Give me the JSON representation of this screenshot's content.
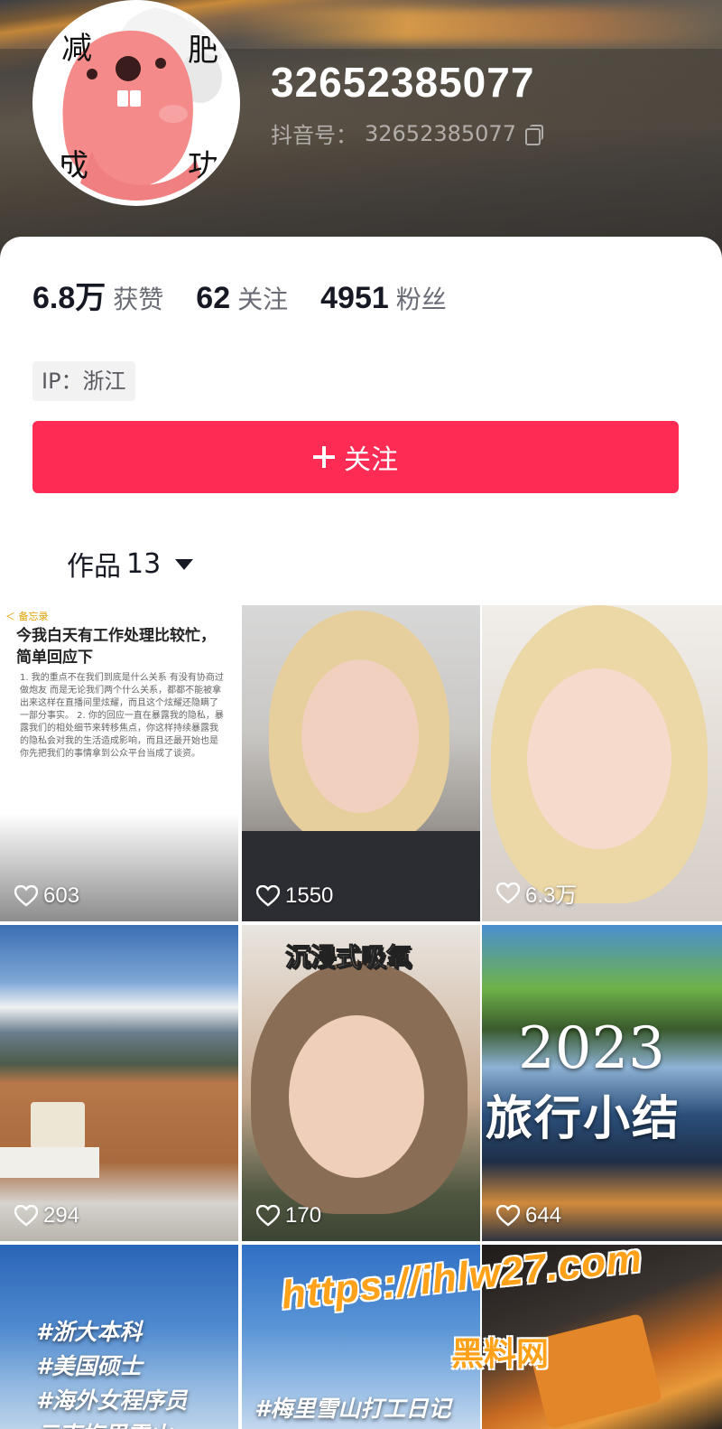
{
  "header": {
    "username": "32652385077",
    "douyin_id_label": "抖音号：",
    "douyin_id": "32652385077",
    "avatar_chars": [
      "减",
      "肥",
      "成",
      "功"
    ]
  },
  "stats": [
    {
      "value": "6.8万",
      "label": "获赞"
    },
    {
      "value": "62",
      "label": "关注"
    },
    {
      "value": "4951",
      "label": "粉丝"
    }
  ],
  "ip_location": "IP：浙江",
  "follow_button": "关注",
  "works_tab": {
    "label": "作品",
    "count": "13"
  },
  "doc_tile": {
    "top_bar": "＜ 备忘录",
    "title": "今我白天有工作处理比较忙，简单回应下",
    "body": "1. 我的重点不在我们到底是什么关系 有没有协商过做炮友 而是无论我们两个什么关系，都都不能被拿出来这样在直播间里炫耀，而且这个炫耀还隐瞒了一部分事实。 2. 你的回应一直在暴露我的隐私，暴露我们的相处细节来转移焦点，你这样持续暴露我的隐私会对我的生活造成影响，而且还最开始也是你先把我们的事情拿到公众平台当成了谈资。"
  },
  "videos": [
    {
      "likes": "603"
    },
    {
      "likes": "1550"
    },
    {
      "likes": "6.3万"
    },
    {
      "likes": "294"
    },
    {
      "likes": "170",
      "caption": "沉浸式吸氧"
    },
    {
      "likes": "644",
      "caption_year": "2023",
      "caption_text": "旅行小结"
    },
    {
      "tags": [
        "#浙大本科",
        "#美国硕士",
        "#海外女程序员",
        "云南梅里雪山"
      ]
    },
    {
      "tag": "#梅里雪山打工日记"
    },
    {}
  ],
  "watermark": {
    "url": "https://ihlw27.com",
    "text": "黑料网"
  },
  "colors": {
    "accent": "#fe2c55",
    "watermark": "#ffa21a"
  }
}
